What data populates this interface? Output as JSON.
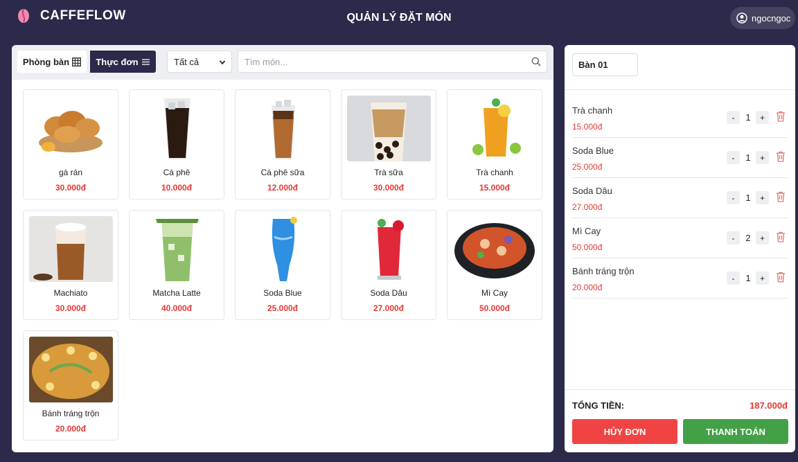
{
  "header": {
    "brand": "CAFFEFLOW",
    "title": "QUẢN LÝ ĐẶT MÓN",
    "username": "ngocngoc"
  },
  "toolbar": {
    "tab_tables": "Phòng bàn",
    "tab_menu": "Thực đơn",
    "category_selected": "Tất cả",
    "search_placeholder": "Tìm món..."
  },
  "menu_items": [
    {
      "name": "gà rán",
      "price": "30.000đ"
    },
    {
      "name": "Cà phê",
      "price": "10.000đ"
    },
    {
      "name": "Cà phê sữa",
      "price": "12.000đ"
    },
    {
      "name": "Trà sữa",
      "price": "30.000đ"
    },
    {
      "name": "Trà chanh",
      "price": "15.000đ"
    },
    {
      "name": "Machiato",
      "price": "30.000đ"
    },
    {
      "name": "Matcha Latte",
      "price": "40.000đ"
    },
    {
      "name": "Soda Blue",
      "price": "25.000đ"
    },
    {
      "name": "Soda Dâu",
      "price": "27.000đ"
    },
    {
      "name": "Mì Cay",
      "price": "50.000đ"
    },
    {
      "name": "Bánh tráng trộn",
      "price": "20.000đ"
    }
  ],
  "order": {
    "table": "Bàn 01",
    "items": [
      {
        "name": "Trà chanh",
        "price": "15.000đ",
        "qty": "1"
      },
      {
        "name": "Soda Blue",
        "price": "25.000đ",
        "qty": "1"
      },
      {
        "name": "Soda Dâu",
        "price": "27.000đ",
        "qty": "1"
      },
      {
        "name": "Mì Cay",
        "price": "50.000đ",
        "qty": "2"
      },
      {
        "name": "Bánh tráng trộn",
        "price": "20.000đ",
        "qty": "1"
      }
    ],
    "minus_label": "-",
    "plus_label": "+",
    "total_label": "TỔNG TIỀN:",
    "total_value": "187.000đ",
    "cancel_label": "HỦY ĐƠN",
    "pay_label": "THANH TOÁN"
  },
  "colors": {
    "background": "#2c2a4a",
    "price": "#e53935",
    "cancel": "#f04444",
    "pay": "#43a047",
    "logo": "#f08ab0"
  }
}
